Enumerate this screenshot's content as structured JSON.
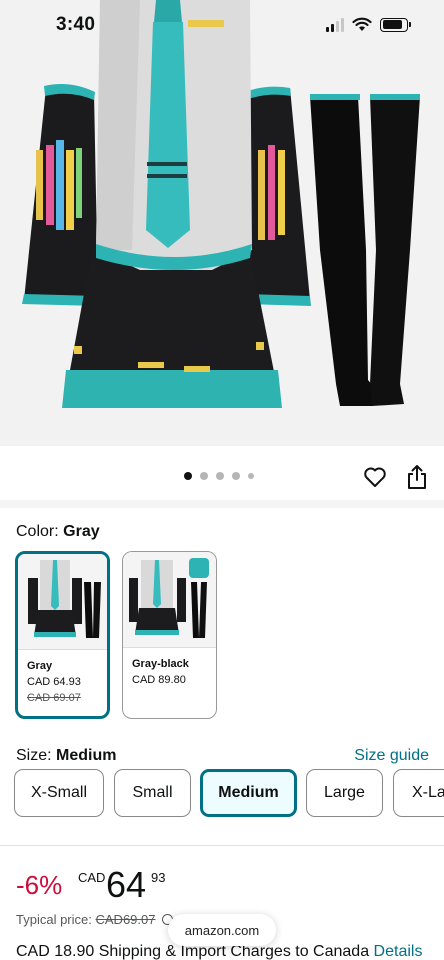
{
  "status_bar": {
    "time": "3:40",
    "icons": [
      "cellular-signal-icon",
      "wifi-icon",
      "battery-icon"
    ],
    "battery_level": 0.85
  },
  "product_image": {
    "carousel": {
      "count": 5,
      "active_index": 0
    },
    "actions": [
      "heart-icon",
      "share-icon"
    ]
  },
  "color": {
    "label": "Color:",
    "selected_value": "Gray",
    "options": [
      {
        "name": "Gray",
        "price": "CAD 64.93",
        "old_price": "CAD 69.07",
        "selected": true
      },
      {
        "name": "Gray-black",
        "price": "CAD 89.80",
        "old_price": "",
        "selected": false
      }
    ]
  },
  "size": {
    "label": "Size:",
    "selected_value": "Medium",
    "guide_link": "Size guide",
    "options": [
      "X-Small",
      "Small",
      "Medium",
      "Large",
      "X-La"
    ]
  },
  "price": {
    "discount": "-6%",
    "currency": "CAD",
    "whole": "64",
    "fraction": "93",
    "typical_label": "Typical price:",
    "typical_value": "CAD69.07"
  },
  "shipping": {
    "text": "CAD 18.90 Shipping & Import Charges to Canada",
    "details_link": "Details"
  },
  "browser": {
    "url": "amazon.com"
  },
  "colors": {
    "accent": "#007185",
    "discount": "#cc0c39",
    "selected_bg": "#edfdff",
    "teal": "#2db3b3"
  }
}
